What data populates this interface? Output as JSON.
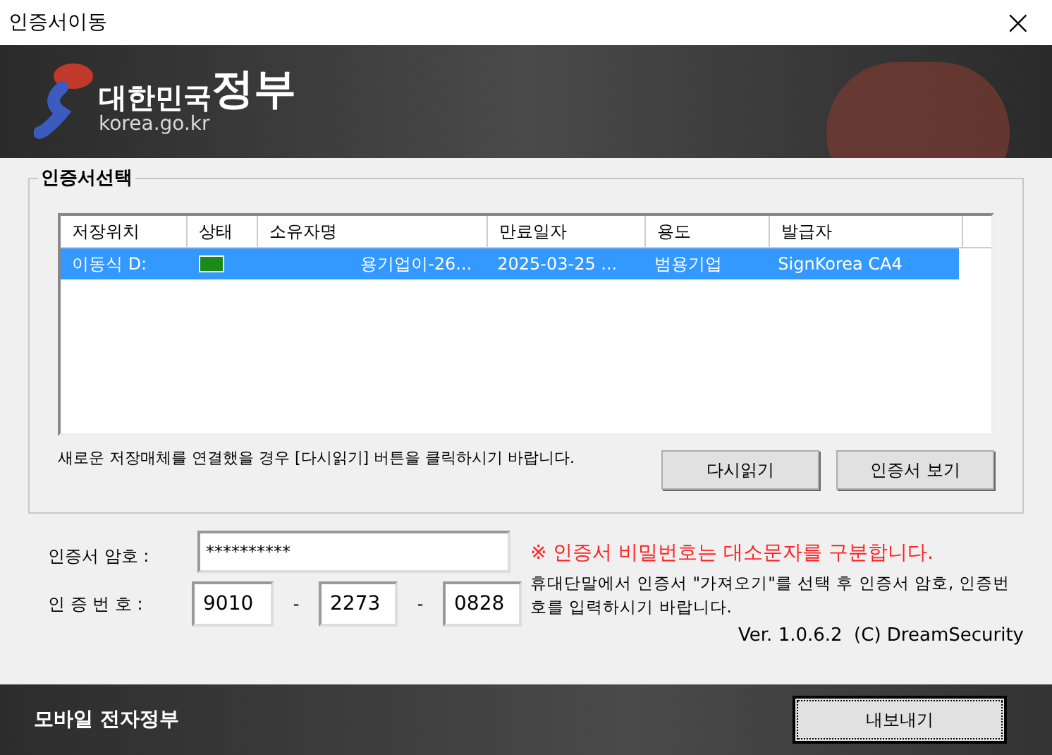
{
  "window": {
    "title": "인증서이동",
    "close": "×"
  },
  "banner": {
    "logo_title": "대한민국",
    "logo_title_bold": "정부",
    "logo_url": "korea.go.kr"
  },
  "certificate_group": {
    "title": "인증서선택",
    "table": {
      "columns": [
        "저장위치",
        "상태",
        "소유자명",
        "만료일자",
        "용도",
        "발급자"
      ],
      "rows": [
        {
          "selected": true,
          "cells": [
            "이동식 D:",
            "",
            "용기업이-26...",
            "2025-03-25 ...",
            "범용기업",
            "SignKorea CA4"
          ]
        }
      ]
    },
    "hint": "새로운 저장매체를 연결했을 경우 [다시읽기] 버튼을 클릭하시기 바랍니다.",
    "buttons": [
      "다시읽기",
      "인증서 보기"
    ]
  },
  "form": {
    "password_label": "인증서 암호 :",
    "password_value": "**********",
    "code_label": "인 증 번 호 :",
    "code_parts": [
      "9010",
      "2273",
      "0828"
    ],
    "separator": "-",
    "warning": "※ 인증서 비밀번호는 대소문자를 구분합니다.",
    "info": "휴대단말에서 인증서 \"가져오기\"를 선택 후 인증서 암호, 인증번호를 입력하시기 바랍니다.",
    "version": "Ver. 1.0.6.2  (C) DreamSecurity"
  },
  "footer": {
    "title": "모바일 전자정부",
    "export_button": "내보내기"
  }
}
